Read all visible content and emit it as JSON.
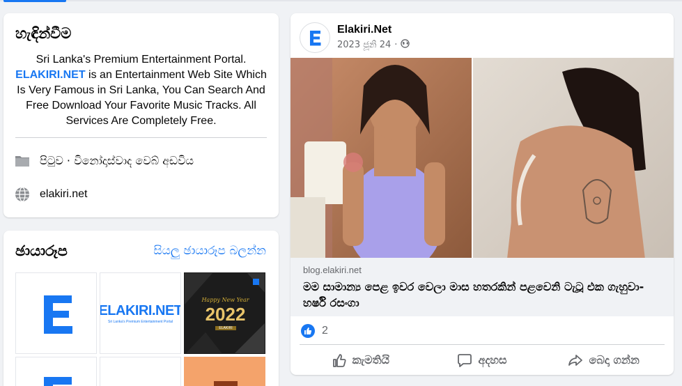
{
  "intro": {
    "title": "හැඳින්වීම",
    "bio_line1": "Sri Lanka's Premium Entertainment Portal.",
    "bio_brand": "ELAKIRI.NET",
    "bio_rest": " is an Entertainment Web Site Which Is Very Famous in Sri Lanka, You Can Search And Free Download Your Favorite Music Tracks. All Services Are Completely Free.",
    "page_category": "පිටුව · විනෝදාස්වාද වෙබ් අඩවිය",
    "website": "elakiri.net"
  },
  "photos": {
    "title": "ඡායාරූප",
    "see_all": "සියලු ඡායාරූප බලන්න",
    "tiles": [
      {
        "kind": "logo-e"
      },
      {
        "kind": "wordmark",
        "text": "ELAKIRI.NET",
        "sub": "Sri Lanka's Premium Entertainment Portal"
      },
      {
        "kind": "new-year",
        "text1": "Happy New Year",
        "text2": "2022",
        "text3": "ELAKIRI"
      },
      {
        "kind": "logo-e"
      },
      {
        "kind": "blank"
      },
      {
        "kind": "orange"
      }
    ]
  },
  "post": {
    "page_name": "Elakiri.Net",
    "date": "2023 ජූනි 24",
    "separator": "·",
    "privacy_icon": "globe-icon",
    "link_domain": "blog.elakiri.net",
    "link_title": "මම සාමාන්‍ය පෙළ ඉවර වෙලා මාස හතරකින් පළවෙනි ටැටූ එක ගැහුවා- හර්ෂි රසංගා",
    "like_count": "2",
    "actions": {
      "like": "කැමතියි",
      "comment": "අදහස",
      "share": "බෙදා ගන්න"
    }
  },
  "colors": {
    "accent": "#1877f2",
    "background": "#f0f2f5",
    "secondary_text": "#65676b"
  }
}
